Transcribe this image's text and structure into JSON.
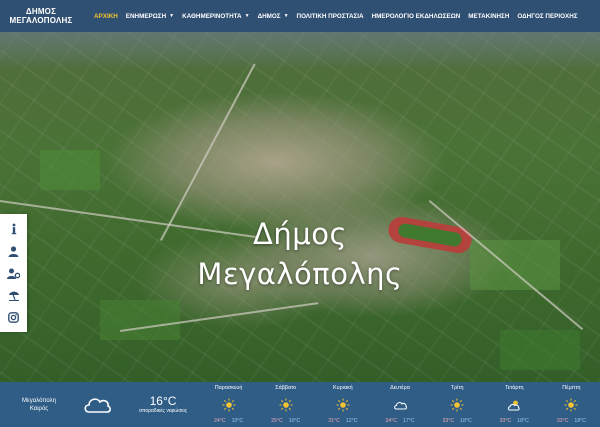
{
  "header": {
    "logo_line1": "ΔΗΜΟΣ",
    "logo_line2": "ΜΕΓΑΛΟΠΟΛΗΣ",
    "nav": [
      {
        "label": "ΑΡΧΙΚΗ",
        "active": true,
        "dropdown": false
      },
      {
        "label": "ΕΝΗΜΕΡΩΣΗ",
        "active": false,
        "dropdown": true
      },
      {
        "label": "ΚΑΘΗΜΕΡΙΝΟΤΗΤΑ",
        "active": false,
        "dropdown": true
      },
      {
        "label": "ΔΗΜΟΣ",
        "active": false,
        "dropdown": true
      },
      {
        "label": "ΠΟΛΙΤΙΚΗ ΠΡΟΣΤΑΣΙΑ",
        "active": false,
        "dropdown": false
      },
      {
        "label": "ΗΜΕΡΟΛΟΓΙΟ ΕΚΔΗΛΩΣΕΩΝ",
        "active": false,
        "dropdown": false
      },
      {
        "label": "ΜΕΤΑΚΙΝΗΣΗ",
        "active": false,
        "dropdown": false
      },
      {
        "label": "ΟΔΗΓΟΣ ΠΕΡΙΟΧΗΣ",
        "active": false,
        "dropdown": false
      }
    ]
  },
  "hero": {
    "title_line1": "Δήμος",
    "title_line2": "Μεγαλόπολης"
  },
  "sidebar": {
    "buttons": [
      "info-icon",
      "user-icon",
      "users-gear-icon",
      "umbrella-beach-icon",
      "instagram-icon"
    ]
  },
  "weather": {
    "city": "Μεγαλόπολη",
    "condition": "Καιρός",
    "current_icon": "cloud-icon",
    "current_temp": "16°C",
    "current_desc": "σποραδικές νεφώσεις",
    "days": [
      {
        "name": "Παρασκευή",
        "icon": "sun-icon",
        "max": "24°C",
        "min": "10°C"
      },
      {
        "name": "Σάββατο",
        "icon": "sun-icon",
        "max": "25°C",
        "min": "10°C"
      },
      {
        "name": "Κυριακή",
        "icon": "sun-icon",
        "max": "31°C",
        "min": "12°C"
      },
      {
        "name": "Δευτέρα",
        "icon": "cloud-icon",
        "max": "34°C",
        "min": "17°C"
      },
      {
        "name": "Τρίτη",
        "icon": "sun-icon",
        "max": "33°C",
        "min": "18°C"
      },
      {
        "name": "Τετάρτη",
        "icon": "sun-cloud-icon",
        "max": "33°C",
        "min": "18°C"
      },
      {
        "name": "Πέμπτη",
        "icon": "sun-icon",
        "max": "33°C",
        "min": "18°C"
      }
    ]
  },
  "colors": {
    "header_bg": "#2f4f73",
    "nav_active": "#f2c230",
    "weather_bg": "#2f5d86",
    "temp_max": "#f0a9b6",
    "temp_min": "#9ec8f0"
  }
}
